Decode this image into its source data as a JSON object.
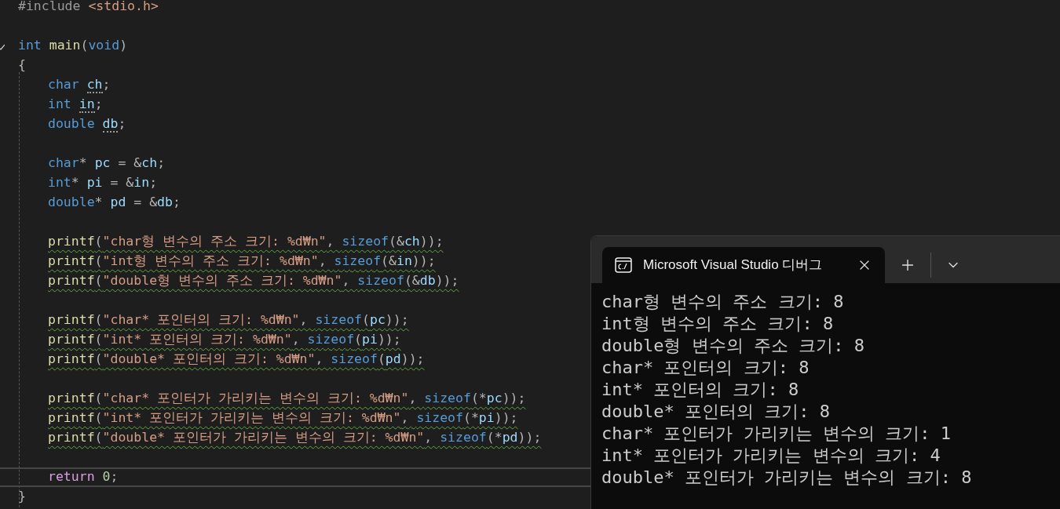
{
  "editor": {
    "lines": [
      {
        "kind": "code",
        "indented": false,
        "warning": false,
        "current": false,
        "foldable": false,
        "tokens": [
          {
            "text": "#include ",
            "kind": "pre"
          },
          {
            "text": "<stdio.h>",
            "kind": "str"
          }
        ]
      },
      {
        "kind": "blank"
      },
      {
        "kind": "code",
        "indented": false,
        "warning": false,
        "current": false,
        "foldable": true,
        "tokens": [
          {
            "text": "int ",
            "kind": "kw"
          },
          {
            "text": "main",
            "kind": "fn"
          },
          {
            "text": "(",
            "kind": "punct"
          },
          {
            "text": "void",
            "kind": "kw"
          },
          {
            "text": ")",
            "kind": "punct"
          }
        ]
      },
      {
        "kind": "code",
        "indented": false,
        "warning": false,
        "current": false,
        "foldable": false,
        "tokens": [
          {
            "text": "{",
            "kind": "punct"
          }
        ]
      },
      {
        "kind": "code",
        "indented": true,
        "warning": false,
        "current": false,
        "foldable": false,
        "tokens": [
          {
            "text": "char ",
            "kind": "kw"
          },
          {
            "text": "ch",
            "kind": "var",
            "hint": true
          },
          {
            "text": ";",
            "kind": "punct"
          }
        ]
      },
      {
        "kind": "code",
        "indented": true,
        "warning": false,
        "current": false,
        "foldable": false,
        "tokens": [
          {
            "text": "int ",
            "kind": "kw"
          },
          {
            "text": "in",
            "kind": "var",
            "hint": true
          },
          {
            "text": ";",
            "kind": "punct"
          }
        ]
      },
      {
        "kind": "code",
        "indented": true,
        "warning": false,
        "current": false,
        "foldable": false,
        "tokens": [
          {
            "text": "double ",
            "kind": "kw"
          },
          {
            "text": "db",
            "kind": "var",
            "hint": true
          },
          {
            "text": ";",
            "kind": "punct"
          }
        ]
      },
      {
        "kind": "blank"
      },
      {
        "kind": "code",
        "indented": true,
        "warning": false,
        "current": false,
        "foldable": false,
        "tokens": [
          {
            "text": "char",
            "kind": "kw"
          },
          {
            "text": "* ",
            "kind": "punct"
          },
          {
            "text": "pc",
            "kind": "var"
          },
          {
            "text": " = &",
            "kind": "punct"
          },
          {
            "text": "ch",
            "kind": "var"
          },
          {
            "text": ";",
            "kind": "punct"
          }
        ]
      },
      {
        "kind": "code",
        "indented": true,
        "warning": false,
        "current": false,
        "foldable": false,
        "tokens": [
          {
            "text": "int",
            "kind": "kw"
          },
          {
            "text": "* ",
            "kind": "punct"
          },
          {
            "text": "pi",
            "kind": "var"
          },
          {
            "text": " = &",
            "kind": "punct"
          },
          {
            "text": "in",
            "kind": "var"
          },
          {
            "text": ";",
            "kind": "punct"
          }
        ]
      },
      {
        "kind": "code",
        "indented": true,
        "warning": false,
        "current": false,
        "foldable": false,
        "tokens": [
          {
            "text": "double",
            "kind": "kw"
          },
          {
            "text": "* ",
            "kind": "punct"
          },
          {
            "text": "pd",
            "kind": "var"
          },
          {
            "text": " = &",
            "kind": "punct"
          },
          {
            "text": "db",
            "kind": "var"
          },
          {
            "text": ";",
            "kind": "punct"
          }
        ]
      },
      {
        "kind": "blank"
      },
      {
        "kind": "code",
        "indented": true,
        "warning": true,
        "current": false,
        "foldable": false,
        "tokens": [
          {
            "text": "printf",
            "kind": "fn"
          },
          {
            "text": "(",
            "kind": "punct"
          },
          {
            "text": "\"char형 변수의 주소 크기: %d₩n\"",
            "kind": "str"
          },
          {
            "text": ", ",
            "kind": "punct"
          },
          {
            "text": "sizeof",
            "kind": "kw"
          },
          {
            "text": "(&",
            "kind": "punct"
          },
          {
            "text": "ch",
            "kind": "var"
          },
          {
            "text": "));",
            "kind": "punct"
          }
        ]
      },
      {
        "kind": "code",
        "indented": true,
        "warning": true,
        "current": false,
        "foldable": false,
        "tokens": [
          {
            "text": "printf",
            "kind": "fn"
          },
          {
            "text": "(",
            "kind": "punct"
          },
          {
            "text": "\"int형 변수의 주소 크기: %d₩n\"",
            "kind": "str"
          },
          {
            "text": ", ",
            "kind": "punct"
          },
          {
            "text": "sizeof",
            "kind": "kw"
          },
          {
            "text": "(&",
            "kind": "punct"
          },
          {
            "text": "in",
            "kind": "var"
          },
          {
            "text": "));",
            "kind": "punct"
          }
        ]
      },
      {
        "kind": "code",
        "indented": true,
        "warning": true,
        "current": false,
        "foldable": false,
        "tokens": [
          {
            "text": "printf",
            "kind": "fn"
          },
          {
            "text": "(",
            "kind": "punct"
          },
          {
            "text": "\"double형 변수의 주소 크기: %d₩n\"",
            "kind": "str"
          },
          {
            "text": ", ",
            "kind": "punct"
          },
          {
            "text": "sizeof",
            "kind": "kw"
          },
          {
            "text": "(&",
            "kind": "punct"
          },
          {
            "text": "db",
            "kind": "var"
          },
          {
            "text": "));",
            "kind": "punct"
          }
        ]
      },
      {
        "kind": "blank"
      },
      {
        "kind": "code",
        "indented": true,
        "warning": true,
        "current": false,
        "foldable": false,
        "tokens": [
          {
            "text": "printf",
            "kind": "fn"
          },
          {
            "text": "(",
            "kind": "punct"
          },
          {
            "text": "\"char* 포인터의 크기: %d₩n\"",
            "kind": "str"
          },
          {
            "text": ", ",
            "kind": "punct"
          },
          {
            "text": "sizeof",
            "kind": "kw"
          },
          {
            "text": "(",
            "kind": "punct"
          },
          {
            "text": "pc",
            "kind": "var"
          },
          {
            "text": "));",
            "kind": "punct"
          }
        ]
      },
      {
        "kind": "code",
        "indented": true,
        "warning": true,
        "current": false,
        "foldable": false,
        "tokens": [
          {
            "text": "printf",
            "kind": "fn"
          },
          {
            "text": "(",
            "kind": "punct"
          },
          {
            "text": "\"int* 포인터의 크기: %d₩n\"",
            "kind": "str"
          },
          {
            "text": ", ",
            "kind": "punct"
          },
          {
            "text": "sizeof",
            "kind": "kw"
          },
          {
            "text": "(",
            "kind": "punct"
          },
          {
            "text": "pi",
            "kind": "var"
          },
          {
            "text": "));",
            "kind": "punct"
          }
        ]
      },
      {
        "kind": "code",
        "indented": true,
        "warning": true,
        "current": false,
        "foldable": false,
        "tokens": [
          {
            "text": "printf",
            "kind": "fn"
          },
          {
            "text": "(",
            "kind": "punct"
          },
          {
            "text": "\"double* 포인터의 크기: %d₩n\"",
            "kind": "str"
          },
          {
            "text": ", ",
            "kind": "punct"
          },
          {
            "text": "sizeof",
            "kind": "kw"
          },
          {
            "text": "(",
            "kind": "punct"
          },
          {
            "text": "pd",
            "kind": "var"
          },
          {
            "text": "));",
            "kind": "punct"
          }
        ]
      },
      {
        "kind": "blank"
      },
      {
        "kind": "code",
        "indented": true,
        "warning": true,
        "current": false,
        "foldable": false,
        "tokens": [
          {
            "text": "printf",
            "kind": "fn"
          },
          {
            "text": "(",
            "kind": "punct"
          },
          {
            "text": "\"char* 포인터가 가리키는 변수의 크기: %d₩n\"",
            "kind": "str"
          },
          {
            "text": ", ",
            "kind": "punct"
          },
          {
            "text": "sizeof",
            "kind": "kw"
          },
          {
            "text": "(*",
            "kind": "punct"
          },
          {
            "text": "pc",
            "kind": "var"
          },
          {
            "text": "));",
            "kind": "punct"
          }
        ]
      },
      {
        "kind": "code",
        "indented": true,
        "warning": true,
        "current": false,
        "foldable": false,
        "tokens": [
          {
            "text": "printf",
            "kind": "fn"
          },
          {
            "text": "(",
            "kind": "punct"
          },
          {
            "text": "\"int* 포인터가 가리키는 변수의 크기: %d₩n\"",
            "kind": "str"
          },
          {
            "text": ", ",
            "kind": "punct"
          },
          {
            "text": "sizeof",
            "kind": "kw"
          },
          {
            "text": "(*",
            "kind": "punct"
          },
          {
            "text": "pi",
            "kind": "var"
          },
          {
            "text": "));",
            "kind": "punct"
          }
        ]
      },
      {
        "kind": "code",
        "indented": true,
        "warning": true,
        "current": false,
        "foldable": false,
        "tokens": [
          {
            "text": "printf",
            "kind": "fn"
          },
          {
            "text": "(",
            "kind": "punct"
          },
          {
            "text": "\"double* 포인터가 가리키는 변수의 크기: %d₩n\"",
            "kind": "str"
          },
          {
            "text": ", ",
            "kind": "punct"
          },
          {
            "text": "sizeof",
            "kind": "kw"
          },
          {
            "text": "(*",
            "kind": "punct"
          },
          {
            "text": "pd",
            "kind": "var"
          },
          {
            "text": "));",
            "kind": "punct"
          }
        ]
      },
      {
        "kind": "blank"
      },
      {
        "kind": "code",
        "indented": true,
        "warning": false,
        "current": true,
        "foldable": false,
        "tokens": [
          {
            "text": "return ",
            "kind": "ctrl"
          },
          {
            "text": "0",
            "kind": "num"
          },
          {
            "text": ";",
            "kind": "punct"
          }
        ]
      },
      {
        "kind": "code",
        "indented": false,
        "warning": false,
        "current": false,
        "foldable": false,
        "tokens": [
          {
            "text": "}",
            "kind": "punct"
          }
        ]
      }
    ]
  },
  "console": {
    "tab": {
      "title": "Microsoft Visual Studio 디버그",
      "selected": true
    },
    "lines": [
      "char형 변수의 주소 크기: 8",
      "int형 변수의 주소 크기: 8",
      "double형 변수의 주소 크기: 8",
      "char* 포인터의 크기: 8",
      "int* 포인터의 크기: 8",
      "double* 포인터의 크기: 8",
      "char* 포인터가 가리키는 변수의 크기: 1",
      "int* 포인터가 가리키는 변수의 크기: 4",
      "double* 포인터가 가리키는 변수의 크기: 8"
    ]
  }
}
